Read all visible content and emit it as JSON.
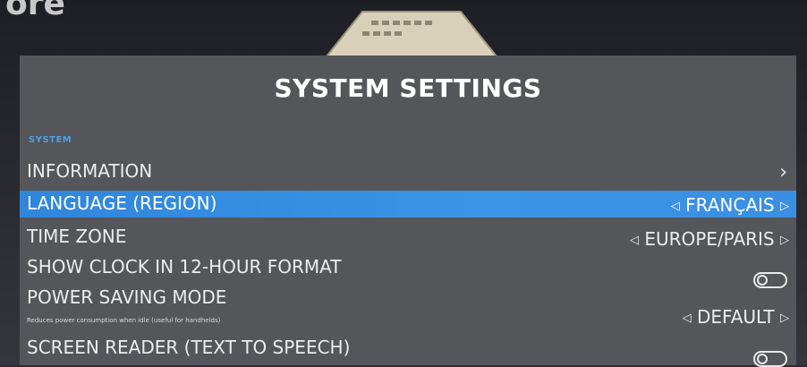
{
  "background": {
    "title_fragment": "ore"
  },
  "title": "SYSTEM SETTINGS",
  "section": "SYSTEM",
  "rows": {
    "information": {
      "label": "INFORMATION"
    },
    "language": {
      "label": "LANGUAGE (REGION)",
      "value": "FRANÇAIS"
    },
    "timezone": {
      "label": "TIME ZONE",
      "value": "EUROPE/PARIS"
    },
    "clock": {
      "label": "SHOW CLOCK IN 12-HOUR FORMAT",
      "enabled": false
    },
    "power": {
      "label": "POWER SAVING MODE",
      "description": "Reduces power consumption when idle (useful for handhelds)",
      "value": "DEFAULT"
    },
    "reader": {
      "label": "SCREEN READER (TEXT TO SPEECH)",
      "enabled": false
    }
  },
  "icons": {
    "chevron": "chevron-right-icon",
    "left": "arrow-left-icon",
    "right": "arrow-right-icon",
    "toggle": "toggle-switch-icon"
  },
  "colors": {
    "selection": "#2f86db",
    "section_label": "#4aa0e8",
    "panel": "#54565a"
  }
}
